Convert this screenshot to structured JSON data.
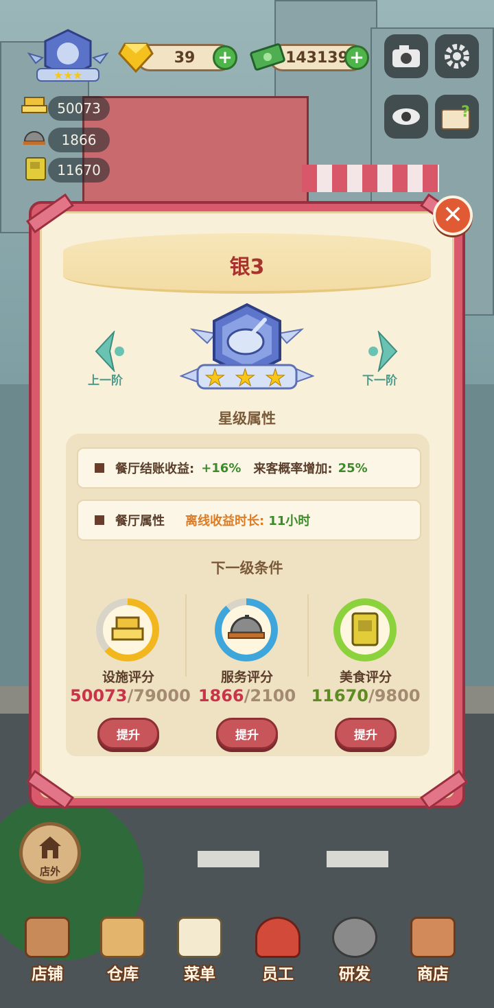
{
  "hud": {
    "gems": "39",
    "cash": "143139",
    "facility_score": "50073",
    "service_score": "1866",
    "food_score": "11670"
  },
  "modal": {
    "title": "银3",
    "prev_label": "上一阶",
    "next_label": "下一阶",
    "star_section_title": "星级属性",
    "row1": {
      "label": "餐厅结账收益:",
      "value": "+16%",
      "label2": "来客概率增加:",
      "value2": "25%"
    },
    "row2": {
      "label": "餐厅属性",
      "label2": "离线收益时长:",
      "value2": "11小时"
    },
    "next_level_title": "下一级条件",
    "conditions": [
      {
        "label": "设施评分",
        "current": "50073",
        "target": "/79000",
        "progress": 0.63,
        "color": "#f2b61f",
        "button": "提升"
      },
      {
        "label": "服务评分",
        "current": "1866",
        "target": "/2100",
        "progress": 0.89,
        "color": "#3fa6dc",
        "button": "提升"
      },
      {
        "label": "美食评分",
        "current": "11670",
        "target": "/9800",
        "progress": 1.0,
        "color": "#8cd23c",
        "button": "提升"
      }
    ],
    "close_glyph": "✕"
  },
  "bottom": {
    "outside_label": "店外",
    "nav": [
      "店铺",
      "仓库",
      "菜单",
      "员工",
      "研发",
      "商店"
    ]
  }
}
